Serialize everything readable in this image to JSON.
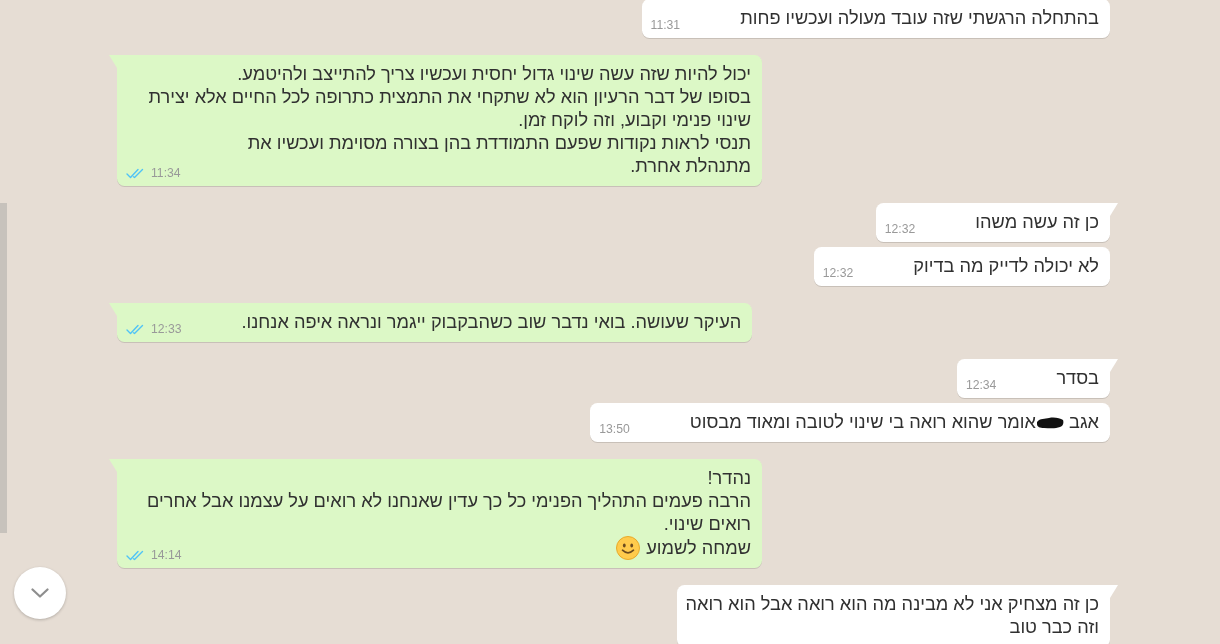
{
  "messages": [
    {
      "kind": "incoming",
      "tail": false,
      "paragraphs": [
        [
          {
            "kind": "text",
            "text": "בהתחלה הרגשתי שזה עובד מעולה ועכשיו פחות"
          }
        ]
      ],
      "time": "11:31"
    },
    {
      "kind": "outgoing",
      "tail": true,
      "paragraphs": [
        [
          {
            "kind": "text",
            "text": "יכול להיות שזה עשה שינוי גדול יחסית ועכשיו צריך להתייצב ולהיטמע."
          }
        ],
        [
          {
            "kind": "text",
            "text": "בסופו של דבר הרעיון הוא לא שתקחי את התמצית כתרופה לכל החיים אלא יצירת שינוי פנימי וקבוע, וזה לוקח זמן."
          }
        ],
        [
          {
            "kind": "text",
            "text": "תנסי לראות נקודות שפעם התמודדת בהן בצורה מסוימת ועכשיו את מתנהלת אחרת."
          }
        ]
      ],
      "time": "11:34",
      "read": true
    },
    {
      "kind": "incoming",
      "tail": true,
      "paragraphs": [
        [
          {
            "kind": "text",
            "text": "כן זה עשה משהו"
          }
        ]
      ],
      "time": "12:32"
    },
    {
      "kind": "incoming",
      "tail": false,
      "paragraphs": [
        [
          {
            "kind": "text",
            "text": "לא יכולה לדייק מה בדיוק"
          }
        ]
      ],
      "time": "12:32"
    },
    {
      "kind": "outgoing",
      "tail": true,
      "paragraphs": [
        [
          {
            "kind": "text",
            "text": "העיקר שעושה. בואי נדבר שוב כשהבקבוק ייגמר ונראה איפה אנחנו."
          }
        ]
      ],
      "time": "12:33",
      "read": true
    },
    {
      "kind": "incoming",
      "tail": true,
      "paragraphs": [
        [
          {
            "kind": "text",
            "text": "בסדר"
          }
        ]
      ],
      "time": "12:34"
    },
    {
      "kind": "incoming",
      "tail": false,
      "paragraphs": [
        [
          {
            "kind": "text",
            "text": "אגב"
          },
          {
            "kind": "redaction"
          },
          {
            "kind": "text",
            "text": "אומר שהוא רואה בי שינוי לטובה ומאוד מבסוט"
          }
        ]
      ],
      "time": "13:50"
    },
    {
      "kind": "outgoing",
      "tail": true,
      "paragraphs": [
        [
          {
            "kind": "text",
            "text": "נהדר!"
          }
        ],
        [
          {
            "kind": "text",
            "text": "הרבה פעמים התהליך הפנימי כל כך עדין שאנחנו לא רואים על עצמנו אבל אחרים רואים שינוי."
          }
        ],
        [
          {
            "kind": "text",
            "text": "שמחה לשמוע"
          },
          {
            "kind": "emoji"
          }
        ]
      ],
      "time": "14:14",
      "read": true
    },
    {
      "kind": "incoming",
      "tail": true,
      "paragraphs": [
        [
          {
            "kind": "text",
            "text": "כן זה מצחיק אני לא מבינה מה הוא רואה אבל הוא רואה"
          }
        ],
        [
          {
            "kind": "text",
            "text": "וזה כבר טוב"
          }
        ]
      ]
    }
  ]
}
